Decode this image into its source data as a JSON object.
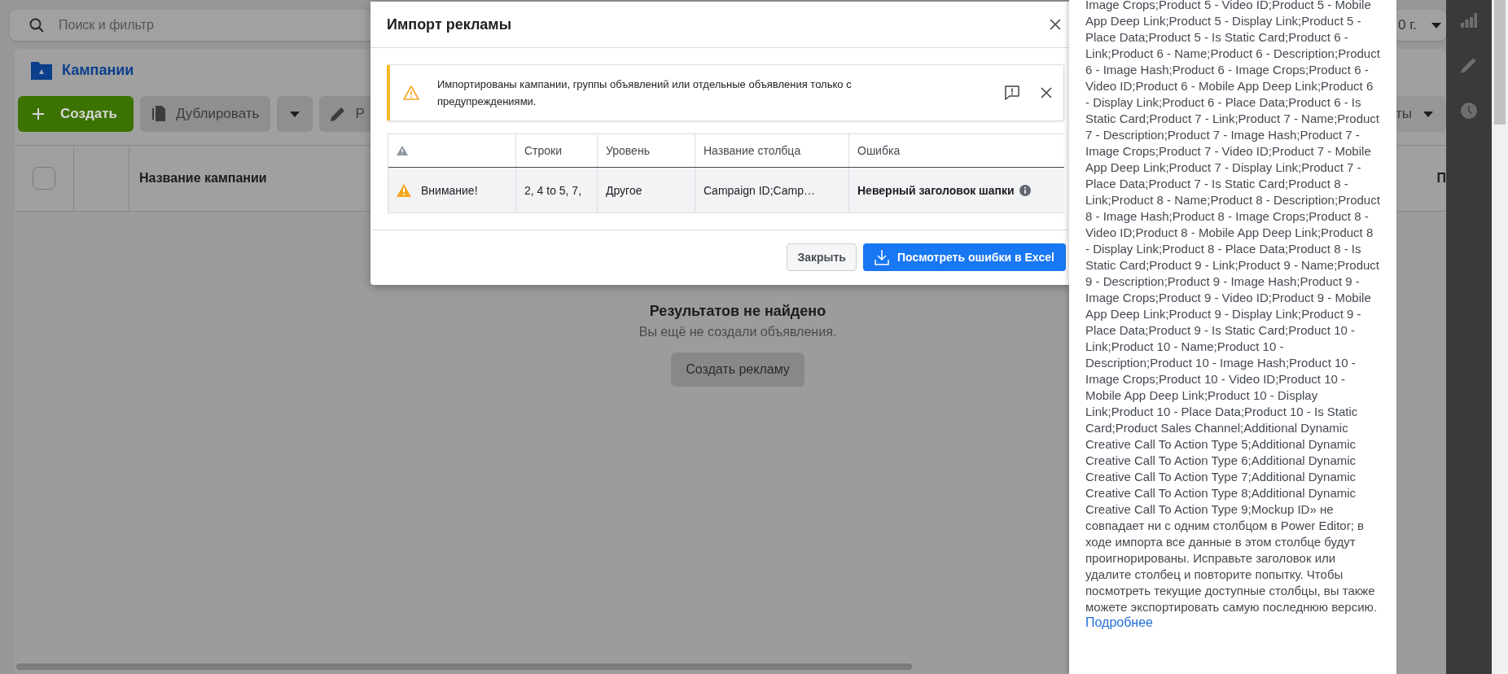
{
  "search": {
    "placeholder": "Поиск и фильтр",
    "date_fragment": "0 г."
  },
  "campaigns_panel": {
    "title": "Кампании"
  },
  "toolbar": {
    "buttons": [
      {
        "kind": "create",
        "label": "Создать"
      },
      {
        "kind": "duplicate",
        "label": "Дублировать"
      },
      {
        "kind": "dropdown"
      },
      {
        "kind": "edit",
        "label": "Р"
      }
    ],
    "right_fragment": "ты"
  },
  "table": {
    "select_all": {
      "checked": false
    },
    "columns": [
      "Название кампании",
      "П"
    ]
  },
  "empty_state": {
    "title": "Результатов не найдено",
    "subtitle": "Вы ещё не создали объявления.",
    "button": "Создать рекламу"
  },
  "dialog": {
    "title": "Импорт рекламы",
    "banner": {
      "kind": "warning",
      "text": "Импортированы кампании, группы объявлений или отдельные объявления только с предупреждениями."
    },
    "columns": [
      {
        "kind": "icon"
      },
      {
        "kind": "text",
        "label": "Строки"
      },
      {
        "kind": "text",
        "label": "Уровень"
      },
      {
        "kind": "text",
        "label": "Название столбца"
      },
      {
        "kind": "text",
        "label": "Ошибка"
      }
    ],
    "rows": [
      {
        "status": "Внимание!",
        "rows": "2, 4 to 5, 7,",
        "category": "Другое",
        "column_name": "Campaign ID;Camp…",
        "error": "Неверный заголовок шапки"
      }
    ],
    "buttons": [
      {
        "kind": "secondary",
        "label": "Закрыть"
      },
      {
        "kind": "primary",
        "label": "Посмотреть ошибки в Excel"
      }
    ]
  },
  "tooltip": {
    "text": "Image Crops;Product 5 - Video ID;Product 5 - Mobile App Deep Link;Product 5 - Display Link;Product 5 - Place Data;Product 5 - Is Static Card;Product 6 - Link;Product 6 - Name;Product 6 - Description;Product 6 - Image Hash;Product 6 - Image Crops;Product 6 - Video ID;Product 6 - Mobile App Deep Link;Product 6 - Display Link;Product 6 - Place Data;Product 6 - Is Static Card;Product 7 - Link;Product 7 - Name;Product 7 - Description;Product 7 - Image Hash;Product 7 - Image Crops;Product 7 - Video ID;Product 7 - Mobile App Deep Link;Product 7 - Display Link;Product 7 - Place Data;Product 7 - Is Static Card;Product 8 - Link;Product 8 - Name;Product 8 - Description;Product 8 - Image Hash;Product 8 - Image Crops;Product 8 - Video ID;Product 8 - Mobile App Deep Link;Product 8 - Display Link;Product 8 - Place Data;Product 8 - Is Static Card;Product 9 - Link;Product 9 - Name;Product 9 - Description;Product 9 - Image Hash;Product 9 - Image Crops;Product 9 - Video ID;Product 9 - Mobile App Deep Link;Product 9 - Display Link;Product 9 - Place Data;Product 9 - Is Static Card;Product 10 - Link;Product 10 - Name;Product 10 - Description;Product 10 - Image Hash;Product 10 - Image Crops;Product 10 - Video ID;Product 10 - Mobile App Deep Link;Product 10 - Display Link;Product 10 - Place Data;Product 10 - Is Static Card;Product Sales Channel;Additional Dynamic Creative Call To Action Type 5;Additional Dynamic Creative Call To Action Type 6;Additional Dynamic Creative Call To Action Type 7;Additional Dynamic Creative Call To Action Type 8;Additional Dynamic Creative Call To Action Type 9;Mockup ID» не совпадает ни с одним столбцом в Power Editor; в ходе импорта все данные в этом столбце будут проигнорированы. Исправьте заголовок или удалите столбец и повторите попытку. Чтобы посмотреть текущие доступные столбцы, вы также можете экспортировать самую последнюю версию.",
    "link": "Подробнее"
  }
}
